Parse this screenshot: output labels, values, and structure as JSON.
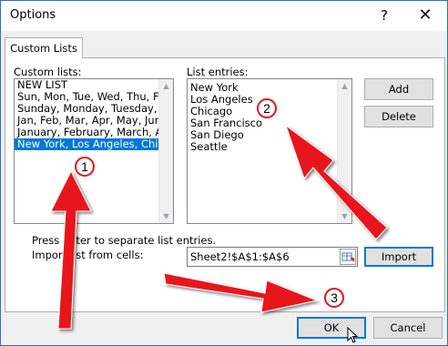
{
  "window": {
    "title": "Options",
    "help_icon": "?",
    "close_icon": "✕"
  },
  "tab": {
    "label": "Custom Lists"
  },
  "custom_lists": {
    "label": "Custom lists:",
    "items": [
      "NEW LIST",
      "Sun, Mon, Tue, Wed, Thu, Fri, S",
      "Sunday, Monday, Tuesday, Wedn",
      "Jan, Feb, Mar, Apr, May, Jun, Jul,",
      "January, February, March, April",
      "New York, Los Angeles, Chicag"
    ],
    "selected_index": 5
  },
  "list_entries": {
    "label": "List entries:",
    "items": [
      "New York",
      "Los Angeles",
      "Chicago",
      "San Francisco",
      "San Diego",
      "Seattle"
    ]
  },
  "buttons": {
    "add": "Add",
    "delete": "Delete",
    "import": "Import",
    "ok": "OK",
    "cancel": "Cancel"
  },
  "hint": "Press Enter to separate list entries.",
  "import_label": "Import list from cells:",
  "import_field_value": "Sheet2!$A$1:$A$6",
  "annotations": {
    "markers": [
      "1",
      "2",
      "3"
    ],
    "color": "#e8141a"
  }
}
